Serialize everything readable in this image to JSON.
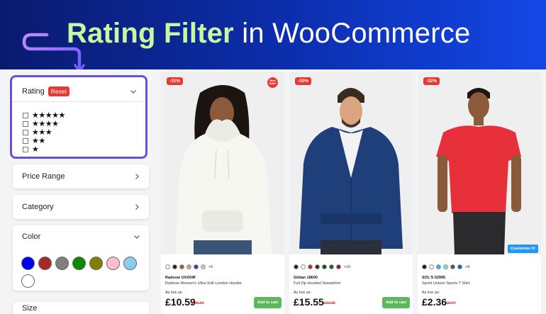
{
  "hero": {
    "title_highlight": "Rating Filter",
    "title_rest": " in WooCommerce",
    "colors": {
      "bg_start": "#0a1b6e",
      "bg_end": "#1447e6",
      "highlight": "#c8f7a0",
      "arrow": "#b07cff"
    }
  },
  "sidebar": {
    "rating": {
      "label": "Rating",
      "reset_label": "Reset",
      "options": [
        "★★★★★",
        "★★★★",
        "★★★",
        "★★",
        "★"
      ],
      "frame_color": "#6d4ed8"
    },
    "price_range": {
      "label": "Price Range"
    },
    "category": {
      "label": "Category"
    },
    "color": {
      "label": "Color",
      "swatches": [
        {
          "name": "blue",
          "hex": "#0000ee"
        },
        {
          "name": "brown",
          "hex": "#a52a2a"
        },
        {
          "name": "grey",
          "hex": "#7f7f7f"
        },
        {
          "name": "green",
          "hex": "#0a8a00"
        },
        {
          "name": "olive",
          "hex": "#808000"
        },
        {
          "name": "pink",
          "hex": "#ffc0cb"
        },
        {
          "name": "light-blue",
          "hex": "#87ceeb"
        },
        {
          "name": "white",
          "hex": "#ffffff"
        }
      ]
    },
    "size": {
      "label": "Size"
    }
  },
  "products": [
    {
      "discount": "-31%",
      "badge": "Best Seller",
      "swatch_colors": [
        "#f5f0e8",
        "#222222",
        "#8a5a44",
        "#c9a27e",
        "#2342a8",
        "#c7c7c7"
      ],
      "more": "+5",
      "brand": "Radsow UXX04F",
      "name": "Radsow Women's Ultra-Soft London Hoodie",
      "as_low_as": "As low as:",
      "price": "£10.59",
      "old_price": "£15.34",
      "cart_label": "Add to cart",
      "garment_color": "#f7f7f2",
      "skin_color": "#8b5a3c"
    },
    {
      "discount": "-30%",
      "swatch_colors": [
        "#222222",
        "#f5f5f5",
        "#c62828",
        "#2e2e2e",
        "#0b4d2b",
        "#1b5e20",
        "#8b1a1a"
      ],
      "more": "+10",
      "brand": "Gildan 18600",
      "name": "Full Zip Hooded Sweatshirt",
      "as_low_as": "As low as:",
      "price": "£15.55",
      "old_price": "£22.25",
      "cart_label": "Add to cart",
      "garment_color": "#1f3f7a",
      "skin_color": "#d9a47f"
    },
    {
      "discount": "-32%",
      "swatch_colors": [
        "#1a1a1a",
        "#f4f4f4",
        "#29b6f6",
        "#81d4fa",
        "#4e5a36",
        "#1565c0"
      ],
      "more": "+8",
      "brand": "SOL'S 02995",
      "name": "Sprint Unisex Sports T Shirt",
      "as_low_as": "As low as:",
      "price": "£2.36",
      "old_price": "£3.47",
      "cart_label": "Add to cart",
      "customise_label": "Customise It!",
      "garment_color": "#e8303a",
      "skin_color": "#8a5a3b"
    }
  ]
}
